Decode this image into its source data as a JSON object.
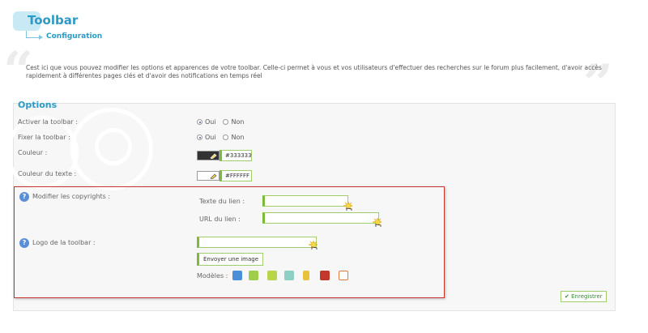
{
  "header": {
    "title": "Toolbar",
    "subtitle": "Configuration"
  },
  "intro": "Cest ici que vous pouvez modifier les options et apparences de votre toolbar. Celle-ci permet à vous et vos utilisateurs d'effectuer des recherches sur le forum plus facilement, d'avoir accès rapidement à différentes pages clés et d'avoir des notifications en temps réel",
  "options": {
    "title": "Options",
    "activate_label": "Activer la toolbar :",
    "fix_label": "Fixer la toolbar :",
    "yes": "Oui",
    "no": "Non",
    "color_label": "Couleur :",
    "color_value": "#333333",
    "text_color_label": "Couleur du texte :",
    "text_color_value": "#FFFFFF",
    "copyright_label": "Modifier les copyrights :",
    "link_text_label": "Texte du lien :",
    "link_url_label": "URL du lien :",
    "logo_label": "Logo de la toolbar :",
    "upload_label": "Envoyer une image",
    "models_label": "Modèles :",
    "save_label": "Enregistrer"
  },
  "colors": {
    "accent": "#2a9bc7",
    "field_border": "#7bbb3a",
    "highlight": "#cc3333",
    "swatch_dark": "#333333",
    "swatch_light": "#FFFFFF"
  },
  "icons": [
    "quote-open-icon",
    "quote-close-icon",
    "help-icon",
    "radio-icon",
    "color-picker-icon",
    "cursor-hand-icon",
    "save-check-icon"
  ]
}
